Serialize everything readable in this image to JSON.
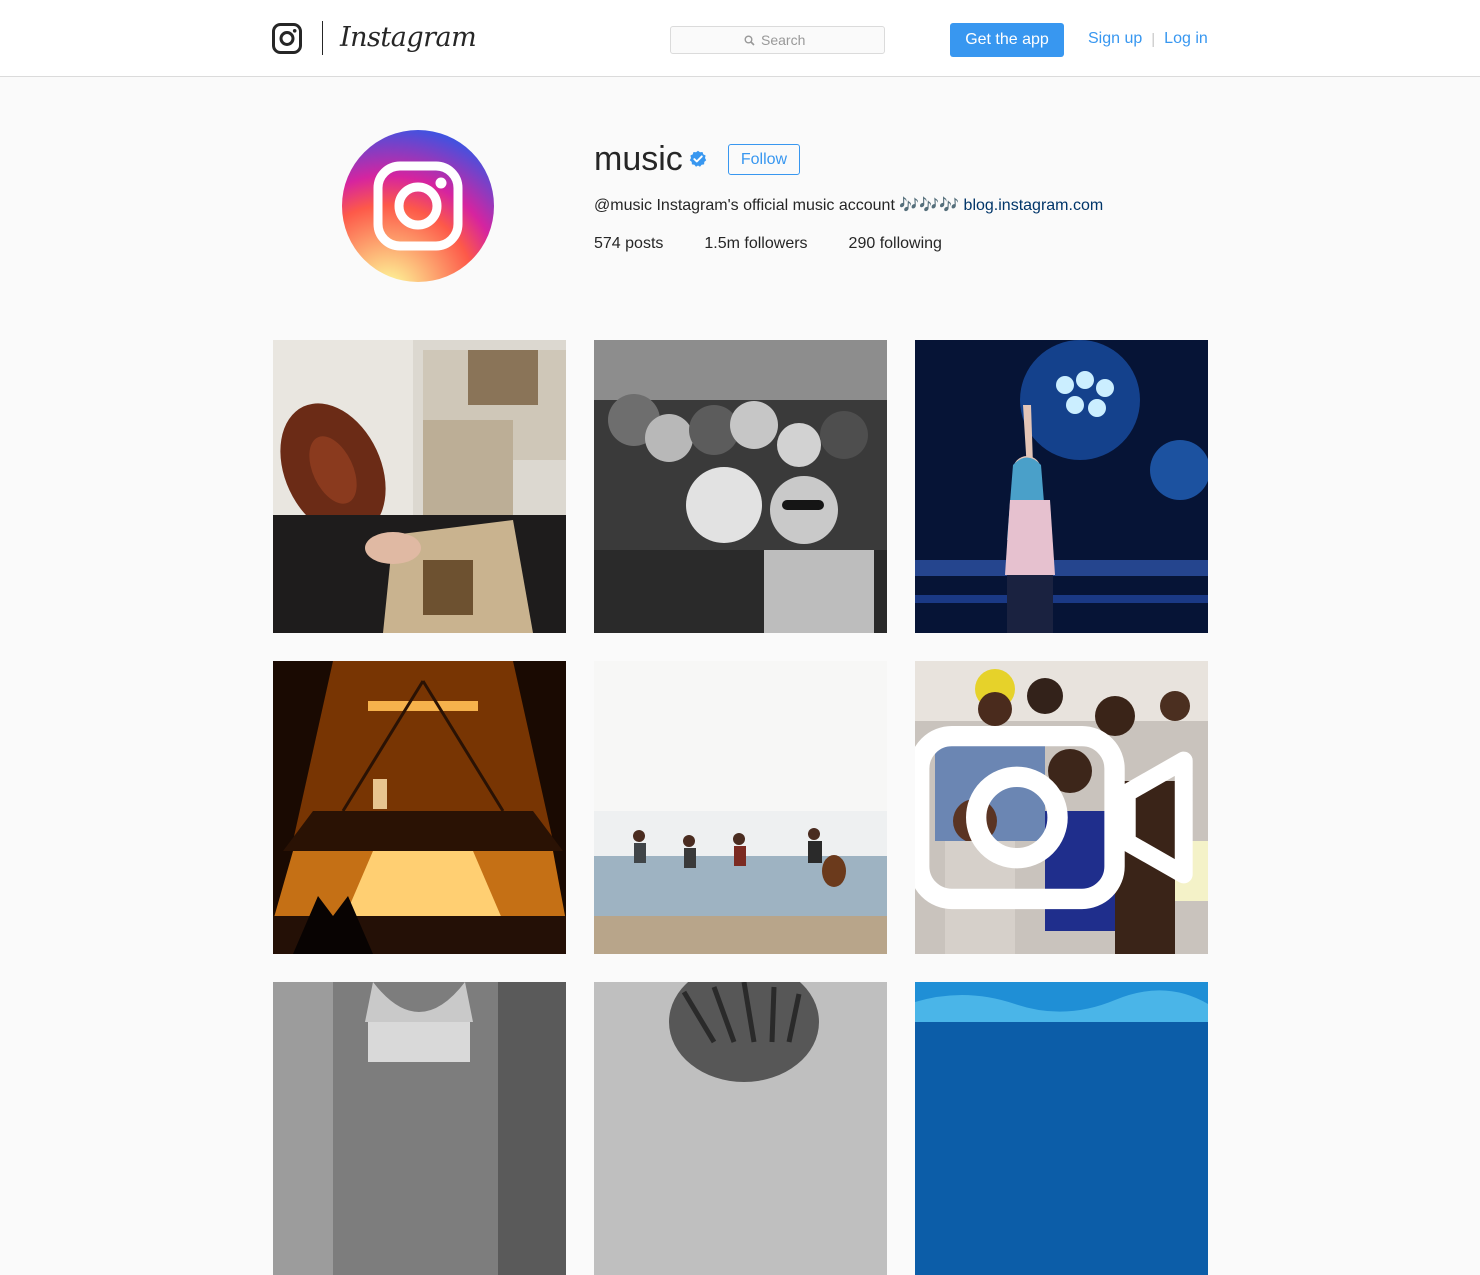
{
  "header": {
    "wordmark": "Instagram",
    "search_placeholder": "Search",
    "get_app_label": "Get the app",
    "sign_up_label": "Sign up",
    "separator": "|",
    "log_in_label": "Log in",
    "icons": [
      "instagram-camera-icon",
      "search-icon"
    ]
  },
  "profile": {
    "username": "music",
    "verified": true,
    "follow_label": "Follow",
    "bio_text": "@music Instagram's official music account 🎶🎶🎶",
    "bio_link": "blog.instagram.com",
    "stats": {
      "posts": "574 posts",
      "followers": "1.5m followers",
      "following": "290 following"
    }
  },
  "posts": [
    {
      "subject": "violin-and-sheet-music",
      "is_video": false
    },
    {
      "subject": "black-and-white-crowd",
      "is_video": false
    },
    {
      "subject": "singer-under-blue-lights",
      "is_video": false
    },
    {
      "subject": "stage-with-orange-lights",
      "is_video": false
    },
    {
      "subject": "band-jumping-by-sea",
      "is_video": false
    },
    {
      "subject": "dancing-crowd",
      "is_video": true
    },
    {
      "subject": "bw-portrait",
      "is_video": false
    },
    {
      "subject": "braided-hair",
      "is_video": false
    },
    {
      "subject": "underwater",
      "is_video": false
    }
  ]
}
